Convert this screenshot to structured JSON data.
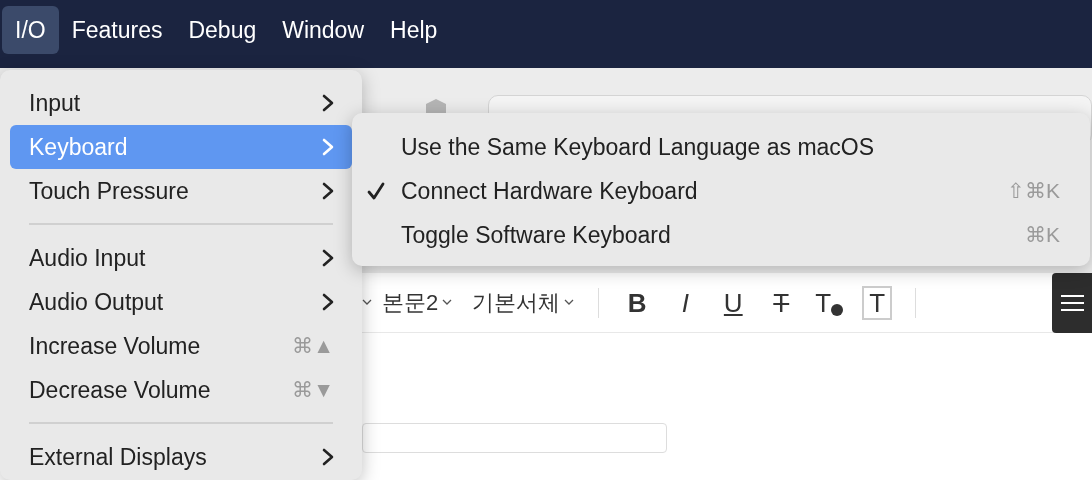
{
  "menu_bar": [
    {
      "label": "I/O",
      "selected": true
    },
    {
      "label": "Features",
      "selected": false
    },
    {
      "label": "Debug",
      "selected": false
    },
    {
      "label": "Window",
      "selected": false
    },
    {
      "label": "Help",
      "selected": false
    }
  ],
  "menu": [
    {
      "kind": "item",
      "label": "Input",
      "submenu": true,
      "selected": false
    },
    {
      "kind": "item",
      "label": "Keyboard",
      "submenu": true,
      "selected": true
    },
    {
      "kind": "item",
      "label": "Touch Pressure",
      "submenu": true,
      "selected": false
    },
    {
      "kind": "separator"
    },
    {
      "kind": "item",
      "label": "Audio Input",
      "submenu": true,
      "selected": false
    },
    {
      "kind": "item",
      "label": "Audio Output",
      "submenu": true,
      "selected": false
    },
    {
      "kind": "item",
      "label": "Increase Volume",
      "shortcut": "⌘▲",
      "selected": false
    },
    {
      "kind": "item",
      "label": "Decrease Volume",
      "shortcut": "⌘▼",
      "selected": false
    },
    {
      "kind": "separator"
    },
    {
      "kind": "item",
      "label": "External Displays",
      "submenu": true,
      "selected": false
    }
  ],
  "submenu": [
    {
      "label": "Use the Same Keyboard Language as macOS",
      "checked": false
    },
    {
      "label": "Connect Hardware Keyboard",
      "checked": true,
      "shortcut": "⇧⌘K"
    },
    {
      "label": "Toggle Software Keyboard",
      "checked": false,
      "shortcut": "⌘K"
    }
  ],
  "toolbar": {
    "dropdowns": [
      "본문2",
      "기본서체"
    ],
    "format_buttons": [
      {
        "kind": "bold",
        "label": "B"
      },
      {
        "kind": "italic",
        "label": "I"
      },
      {
        "kind": "underline",
        "label": "U"
      },
      {
        "kind": "strike",
        "label": "T"
      },
      {
        "kind": "color",
        "label": "T"
      },
      {
        "kind": "background",
        "label": "T"
      }
    ]
  }
}
